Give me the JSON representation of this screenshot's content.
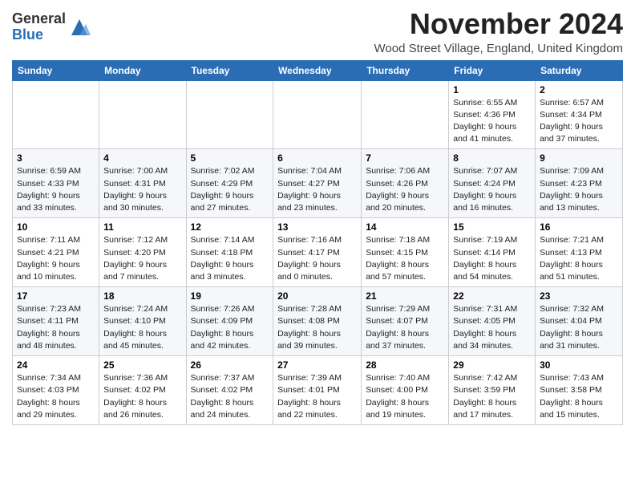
{
  "logo": {
    "general": "General",
    "blue": "Blue"
  },
  "header": {
    "month_title": "November 2024",
    "location": "Wood Street Village, England, United Kingdom"
  },
  "days_of_week": [
    "Sunday",
    "Monday",
    "Tuesday",
    "Wednesday",
    "Thursday",
    "Friday",
    "Saturday"
  ],
  "weeks": [
    [
      {
        "day": "",
        "info": ""
      },
      {
        "day": "",
        "info": ""
      },
      {
        "day": "",
        "info": ""
      },
      {
        "day": "",
        "info": ""
      },
      {
        "day": "",
        "info": ""
      },
      {
        "day": "1",
        "info": "Sunrise: 6:55 AM\nSunset: 4:36 PM\nDaylight: 9 hours\nand 41 minutes."
      },
      {
        "day": "2",
        "info": "Sunrise: 6:57 AM\nSunset: 4:34 PM\nDaylight: 9 hours\nand 37 minutes."
      }
    ],
    [
      {
        "day": "3",
        "info": "Sunrise: 6:59 AM\nSunset: 4:33 PM\nDaylight: 9 hours\nand 33 minutes."
      },
      {
        "day": "4",
        "info": "Sunrise: 7:00 AM\nSunset: 4:31 PM\nDaylight: 9 hours\nand 30 minutes."
      },
      {
        "day": "5",
        "info": "Sunrise: 7:02 AM\nSunset: 4:29 PM\nDaylight: 9 hours\nand 27 minutes."
      },
      {
        "day": "6",
        "info": "Sunrise: 7:04 AM\nSunset: 4:27 PM\nDaylight: 9 hours\nand 23 minutes."
      },
      {
        "day": "7",
        "info": "Sunrise: 7:06 AM\nSunset: 4:26 PM\nDaylight: 9 hours\nand 20 minutes."
      },
      {
        "day": "8",
        "info": "Sunrise: 7:07 AM\nSunset: 4:24 PM\nDaylight: 9 hours\nand 16 minutes."
      },
      {
        "day": "9",
        "info": "Sunrise: 7:09 AM\nSunset: 4:23 PM\nDaylight: 9 hours\nand 13 minutes."
      }
    ],
    [
      {
        "day": "10",
        "info": "Sunrise: 7:11 AM\nSunset: 4:21 PM\nDaylight: 9 hours\nand 10 minutes."
      },
      {
        "day": "11",
        "info": "Sunrise: 7:12 AM\nSunset: 4:20 PM\nDaylight: 9 hours\nand 7 minutes."
      },
      {
        "day": "12",
        "info": "Sunrise: 7:14 AM\nSunset: 4:18 PM\nDaylight: 9 hours\nand 3 minutes."
      },
      {
        "day": "13",
        "info": "Sunrise: 7:16 AM\nSunset: 4:17 PM\nDaylight: 9 hours\nand 0 minutes."
      },
      {
        "day": "14",
        "info": "Sunrise: 7:18 AM\nSunset: 4:15 PM\nDaylight: 8 hours\nand 57 minutes."
      },
      {
        "day": "15",
        "info": "Sunrise: 7:19 AM\nSunset: 4:14 PM\nDaylight: 8 hours\nand 54 minutes."
      },
      {
        "day": "16",
        "info": "Sunrise: 7:21 AM\nSunset: 4:13 PM\nDaylight: 8 hours\nand 51 minutes."
      }
    ],
    [
      {
        "day": "17",
        "info": "Sunrise: 7:23 AM\nSunset: 4:11 PM\nDaylight: 8 hours\nand 48 minutes."
      },
      {
        "day": "18",
        "info": "Sunrise: 7:24 AM\nSunset: 4:10 PM\nDaylight: 8 hours\nand 45 minutes."
      },
      {
        "day": "19",
        "info": "Sunrise: 7:26 AM\nSunset: 4:09 PM\nDaylight: 8 hours\nand 42 minutes."
      },
      {
        "day": "20",
        "info": "Sunrise: 7:28 AM\nSunset: 4:08 PM\nDaylight: 8 hours\nand 39 minutes."
      },
      {
        "day": "21",
        "info": "Sunrise: 7:29 AM\nSunset: 4:07 PM\nDaylight: 8 hours\nand 37 minutes."
      },
      {
        "day": "22",
        "info": "Sunrise: 7:31 AM\nSunset: 4:05 PM\nDaylight: 8 hours\nand 34 minutes."
      },
      {
        "day": "23",
        "info": "Sunrise: 7:32 AM\nSunset: 4:04 PM\nDaylight: 8 hours\nand 31 minutes."
      }
    ],
    [
      {
        "day": "24",
        "info": "Sunrise: 7:34 AM\nSunset: 4:03 PM\nDaylight: 8 hours\nand 29 minutes."
      },
      {
        "day": "25",
        "info": "Sunrise: 7:36 AM\nSunset: 4:02 PM\nDaylight: 8 hours\nand 26 minutes."
      },
      {
        "day": "26",
        "info": "Sunrise: 7:37 AM\nSunset: 4:02 PM\nDaylight: 8 hours\nand 24 minutes."
      },
      {
        "day": "27",
        "info": "Sunrise: 7:39 AM\nSunset: 4:01 PM\nDaylight: 8 hours\nand 22 minutes."
      },
      {
        "day": "28",
        "info": "Sunrise: 7:40 AM\nSunset: 4:00 PM\nDaylight: 8 hours\nand 19 minutes."
      },
      {
        "day": "29",
        "info": "Sunrise: 7:42 AM\nSunset: 3:59 PM\nDaylight: 8 hours\nand 17 minutes."
      },
      {
        "day": "30",
        "info": "Sunrise: 7:43 AM\nSunset: 3:58 PM\nDaylight: 8 hours\nand 15 minutes."
      }
    ]
  ]
}
